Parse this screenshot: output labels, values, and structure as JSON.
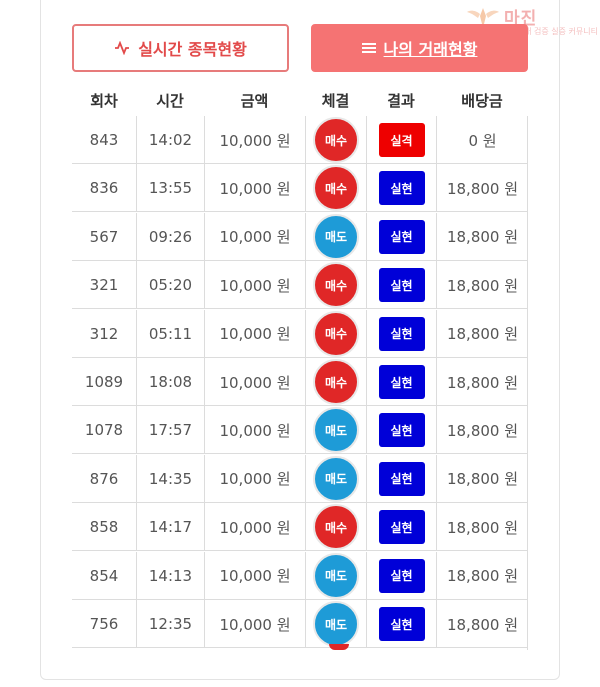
{
  "watermark": {
    "title": "마진",
    "sub": "마진거래 검증 실증 커뮤니티"
  },
  "tabs": [
    {
      "label": "실시간 종목현황",
      "icon": "pulse-icon"
    },
    {
      "label": "나의 거래현황",
      "icon": "menu-icon"
    }
  ],
  "columns": [
    "회차",
    "시간",
    "금액",
    "체결",
    "결과",
    "배당금"
  ],
  "colors": {
    "buy": "#e02727",
    "sell": "#1e9bd7",
    "win": "#0000d8",
    "lose": "#ee0000"
  },
  "rows": [
    {
      "round": "843",
      "time": "14:02",
      "amount": "10,000 원",
      "trade": "매수",
      "trade_type": "buy",
      "result": "실격",
      "result_type": "lose",
      "payout": "0 원"
    },
    {
      "round": "836",
      "time": "13:55",
      "amount": "10,000 원",
      "trade": "매수",
      "trade_type": "buy",
      "result": "실현",
      "result_type": "win",
      "payout": "18,800 원"
    },
    {
      "round": "567",
      "time": "09:26",
      "amount": "10,000 원",
      "trade": "매도",
      "trade_type": "sell",
      "result": "실현",
      "result_type": "win",
      "payout": "18,800 원"
    },
    {
      "round": "321",
      "time": "05:20",
      "amount": "10,000 원",
      "trade": "매수",
      "trade_type": "buy",
      "result": "실현",
      "result_type": "win",
      "payout": "18,800 원"
    },
    {
      "round": "312",
      "time": "05:11",
      "amount": "10,000 원",
      "trade": "매수",
      "trade_type": "buy",
      "result": "실현",
      "result_type": "win",
      "payout": "18,800 원"
    },
    {
      "round": "1089",
      "time": "18:08",
      "amount": "10,000 원",
      "trade": "매수",
      "trade_type": "buy",
      "result": "실현",
      "result_type": "win",
      "payout": "18,800 원"
    },
    {
      "round": "1078",
      "time": "17:57",
      "amount": "10,000 원",
      "trade": "매도",
      "trade_type": "sell",
      "result": "실현",
      "result_type": "win",
      "payout": "18,800 원"
    },
    {
      "round": "876",
      "time": "14:35",
      "amount": "10,000 원",
      "trade": "매도",
      "trade_type": "sell",
      "result": "실현",
      "result_type": "win",
      "payout": "18,800 원"
    },
    {
      "round": "858",
      "time": "14:17",
      "amount": "10,000 원",
      "trade": "매수",
      "trade_type": "buy",
      "result": "실현",
      "result_type": "win",
      "payout": "18,800 원"
    },
    {
      "round": "854",
      "time": "14:13",
      "amount": "10,000 원",
      "trade": "매도",
      "trade_type": "sell",
      "result": "실현",
      "result_type": "win",
      "payout": "18,800 원"
    },
    {
      "round": "756",
      "time": "12:35",
      "amount": "10,000 원",
      "trade": "매도",
      "trade_type": "sell",
      "result": "실현",
      "result_type": "win",
      "payout": "18,800 원"
    }
  ]
}
